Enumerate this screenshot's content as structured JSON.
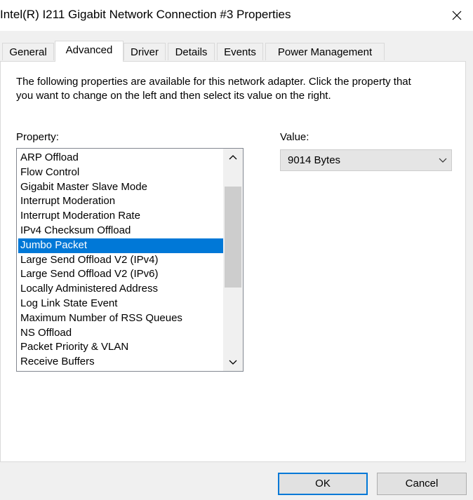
{
  "window": {
    "title": "Intel(R) I211 Gigabit Network Connection #3 Properties"
  },
  "tabs": [
    {
      "label": "General"
    },
    {
      "label": "Advanced"
    },
    {
      "label": "Driver"
    },
    {
      "label": "Details"
    },
    {
      "label": "Events"
    },
    {
      "label": "Power Management"
    }
  ],
  "active_tab": "Advanced",
  "advanced": {
    "description": "The following properties are available for this network adapter. Click the property that you want to change on the left and then select its value on the right.",
    "property_label": "Property:",
    "value_label": "Value:",
    "properties": [
      "ARP Offload",
      "Flow Control",
      "Gigabit Master Slave Mode",
      "Interrupt Moderation",
      "Interrupt Moderation Rate",
      "IPv4 Checksum Offload",
      "Jumbo Packet",
      "Large Send Offload V2 (IPv4)",
      "Large Send Offload V2 (IPv6)",
      "Locally Administered Address",
      "Log Link State Event",
      "Maximum Number of RSS Queues",
      "NS Offload",
      "Packet Priority & VLAN",
      "Receive Buffers"
    ],
    "selected_property": "Jumbo Packet",
    "value": "9014 Bytes"
  },
  "buttons": {
    "ok": "OK",
    "cancel": "Cancel"
  },
  "colors": {
    "selection": "#0078d7",
    "dialog_background": "#f0f0f0",
    "default_button_border": "#0078d7"
  },
  "icons": {
    "close": "close-icon",
    "scroll_up": "chevron-up-icon",
    "scroll_down": "chevron-down-icon",
    "dropdown": "chevron-down-icon"
  }
}
